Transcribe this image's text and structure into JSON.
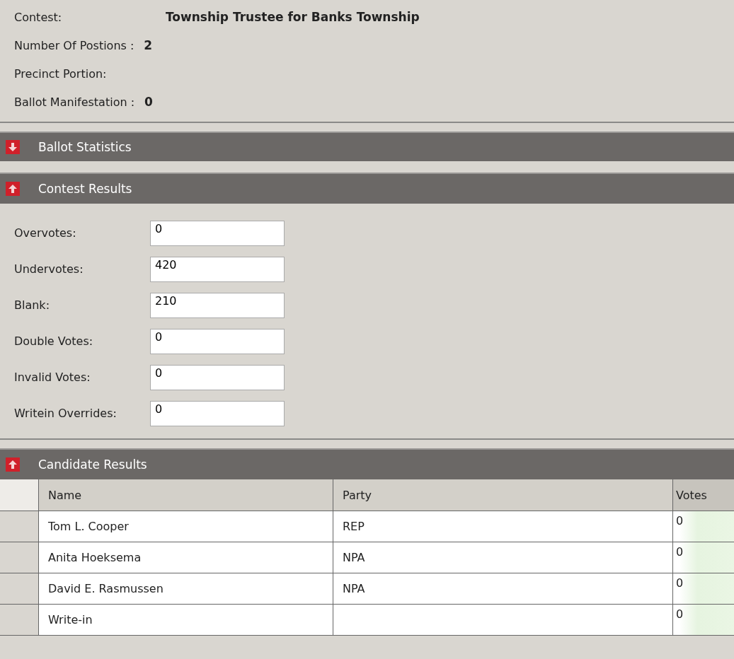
{
  "info": [
    {
      "label": "Contest:",
      "value": "Township Trustee for Banks Township"
    },
    {
      "label": "Number Of Postions :",
      "value": "2"
    },
    {
      "label": "Precinct Portion:"
    },
    {
      "label": "Ballot Manifestation :",
      "value": "0"
    }
  ],
  "ballot_statistics": {
    "title": "Ballot Statistics",
    "expanded": false
  },
  "contest_results": {
    "title": "Contest Results",
    "expanded": true,
    "fields": [
      {
        "label": "Overvotes:",
        "value": "0"
      },
      {
        "label": "Undervotes:",
        "value": "420"
      },
      {
        "label": "Blank:",
        "value": "210"
      },
      {
        "label": "Double Votes:",
        "value": "0"
      },
      {
        "label": "Invalid Votes:",
        "value": "0"
      },
      {
        "label": "Writein Overrides:",
        "value": "0"
      }
    ]
  },
  "candidate_results": {
    "title": "Candidate Results",
    "expanded": true,
    "columns": [
      "Name",
      "Party",
      "Votes"
    ],
    "rows": [
      {
        "name": "Tom L. Cooper",
        "party": "REP",
        "votes": "0"
      },
      {
        "name": "Anita Hoeksema",
        "party": "NPA",
        "votes": "0"
      },
      {
        "name": "David E. Rasmussen",
        "party": "NPA",
        "votes": "0"
      },
      {
        "name": "Write-in",
        "votes": "0"
      }
    ]
  }
}
